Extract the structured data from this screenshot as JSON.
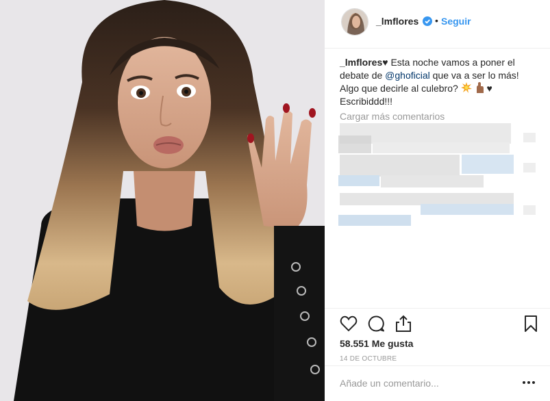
{
  "post": {
    "username": "_lmflores",
    "follow_label": "Seguir",
    "separator": "•",
    "caption": {
      "username": "_lmflores",
      "heart": "♥",
      "text_1": " Esta noche vamos a poner el debate de ",
      "mention": "@ghoficial",
      "text_2": " que va a ser lo más! Algo que decirle al culebro? ",
      "text_3": " ♥ Escribiddd!!!"
    },
    "load_more_label": "Cargar más comentarios",
    "likes_label": "58.551 Me gusta",
    "date_label": "14 DE OCTUBRE",
    "comment_placeholder": "Añade un comentario...",
    "more_label": "•••"
  },
  "icons": {
    "verified": "verified-badge-icon",
    "like": "heart-outline-icon",
    "comment": "speech-bubble-icon",
    "share": "share-upload-icon",
    "save": "bookmark-icon",
    "more": "more-options-icon",
    "collision": "collision-emoji",
    "hand": "fingers-crossed-emoji"
  },
  "colors": {
    "link": "#3897f0",
    "mention": "#003569",
    "text": "#262626",
    "muted": "#999999",
    "border": "#efefef"
  }
}
